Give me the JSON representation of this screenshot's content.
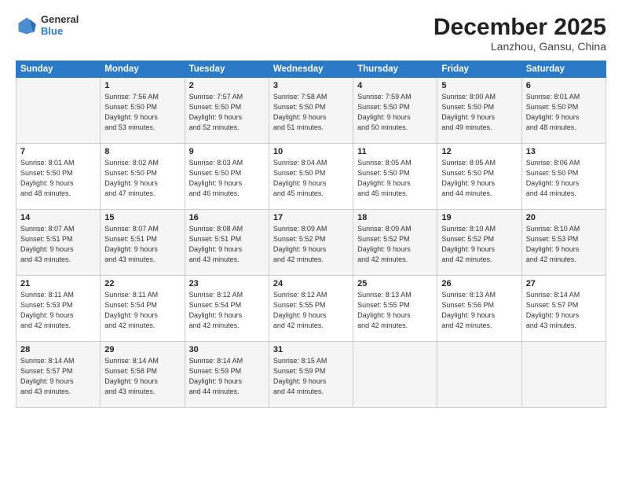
{
  "logo": {
    "general": "General",
    "blue": "Blue"
  },
  "title": "December 2025",
  "location": "Lanzhou, Gansu, China",
  "weekdays": [
    "Sunday",
    "Monday",
    "Tuesday",
    "Wednesday",
    "Thursday",
    "Friday",
    "Saturday"
  ],
  "weeks": [
    [
      {
        "day": "",
        "info": ""
      },
      {
        "day": "1",
        "info": "Sunrise: 7:56 AM\nSunset: 5:50 PM\nDaylight: 9 hours\nand 53 minutes."
      },
      {
        "day": "2",
        "info": "Sunrise: 7:57 AM\nSunset: 5:50 PM\nDaylight: 9 hours\nand 52 minutes."
      },
      {
        "day": "3",
        "info": "Sunrise: 7:58 AM\nSunset: 5:50 PM\nDaylight: 9 hours\nand 51 minutes."
      },
      {
        "day": "4",
        "info": "Sunrise: 7:59 AM\nSunset: 5:50 PM\nDaylight: 9 hours\nand 50 minutes."
      },
      {
        "day": "5",
        "info": "Sunrise: 8:00 AM\nSunset: 5:50 PM\nDaylight: 9 hours\nand 49 minutes."
      },
      {
        "day": "6",
        "info": "Sunrise: 8:01 AM\nSunset: 5:50 PM\nDaylight: 9 hours\nand 48 minutes."
      }
    ],
    [
      {
        "day": "7",
        "info": "Sunrise: 8:01 AM\nSunset: 5:50 PM\nDaylight: 9 hours\nand 48 minutes."
      },
      {
        "day": "8",
        "info": "Sunrise: 8:02 AM\nSunset: 5:50 PM\nDaylight: 9 hours\nand 47 minutes."
      },
      {
        "day": "9",
        "info": "Sunrise: 8:03 AM\nSunset: 5:50 PM\nDaylight: 9 hours\nand 46 minutes."
      },
      {
        "day": "10",
        "info": "Sunrise: 8:04 AM\nSunset: 5:50 PM\nDaylight: 9 hours\nand 45 minutes."
      },
      {
        "day": "11",
        "info": "Sunrise: 8:05 AM\nSunset: 5:50 PM\nDaylight: 9 hours\nand 45 minutes."
      },
      {
        "day": "12",
        "info": "Sunrise: 8:05 AM\nSunset: 5:50 PM\nDaylight: 9 hours\nand 44 minutes."
      },
      {
        "day": "13",
        "info": "Sunrise: 8:06 AM\nSunset: 5:50 PM\nDaylight: 9 hours\nand 44 minutes."
      }
    ],
    [
      {
        "day": "14",
        "info": "Sunrise: 8:07 AM\nSunset: 5:51 PM\nDaylight: 9 hours\nand 43 minutes."
      },
      {
        "day": "15",
        "info": "Sunrise: 8:07 AM\nSunset: 5:51 PM\nDaylight: 9 hours\nand 43 minutes."
      },
      {
        "day": "16",
        "info": "Sunrise: 8:08 AM\nSunset: 5:51 PM\nDaylight: 9 hours\nand 43 minutes."
      },
      {
        "day": "17",
        "info": "Sunrise: 8:09 AM\nSunset: 5:52 PM\nDaylight: 9 hours\nand 42 minutes."
      },
      {
        "day": "18",
        "info": "Sunrise: 8:09 AM\nSunset: 5:52 PM\nDaylight: 9 hours\nand 42 minutes."
      },
      {
        "day": "19",
        "info": "Sunrise: 8:10 AM\nSunset: 5:52 PM\nDaylight: 9 hours\nand 42 minutes."
      },
      {
        "day": "20",
        "info": "Sunrise: 8:10 AM\nSunset: 5:53 PM\nDaylight: 9 hours\nand 42 minutes."
      }
    ],
    [
      {
        "day": "21",
        "info": "Sunrise: 8:11 AM\nSunset: 5:53 PM\nDaylight: 9 hours\nand 42 minutes."
      },
      {
        "day": "22",
        "info": "Sunrise: 8:11 AM\nSunset: 5:54 PM\nDaylight: 9 hours\nand 42 minutes."
      },
      {
        "day": "23",
        "info": "Sunrise: 8:12 AM\nSunset: 5:54 PM\nDaylight: 9 hours\nand 42 minutes."
      },
      {
        "day": "24",
        "info": "Sunrise: 8:12 AM\nSunset: 5:55 PM\nDaylight: 9 hours\nand 42 minutes."
      },
      {
        "day": "25",
        "info": "Sunrise: 8:13 AM\nSunset: 5:55 PM\nDaylight: 9 hours\nand 42 minutes."
      },
      {
        "day": "26",
        "info": "Sunrise: 8:13 AM\nSunset: 5:56 PM\nDaylight: 9 hours\nand 42 minutes."
      },
      {
        "day": "27",
        "info": "Sunrise: 8:14 AM\nSunset: 5:57 PM\nDaylight: 9 hours\nand 43 minutes."
      }
    ],
    [
      {
        "day": "28",
        "info": "Sunrise: 8:14 AM\nSunset: 5:57 PM\nDaylight: 9 hours\nand 43 minutes."
      },
      {
        "day": "29",
        "info": "Sunrise: 8:14 AM\nSunset: 5:58 PM\nDaylight: 9 hours\nand 43 minutes."
      },
      {
        "day": "30",
        "info": "Sunrise: 8:14 AM\nSunset: 5:59 PM\nDaylight: 9 hours\nand 44 minutes."
      },
      {
        "day": "31",
        "info": "Sunrise: 8:15 AM\nSunset: 5:59 PM\nDaylight: 9 hours\nand 44 minutes."
      },
      {
        "day": "",
        "info": ""
      },
      {
        "day": "",
        "info": ""
      },
      {
        "day": "",
        "info": ""
      }
    ]
  ]
}
